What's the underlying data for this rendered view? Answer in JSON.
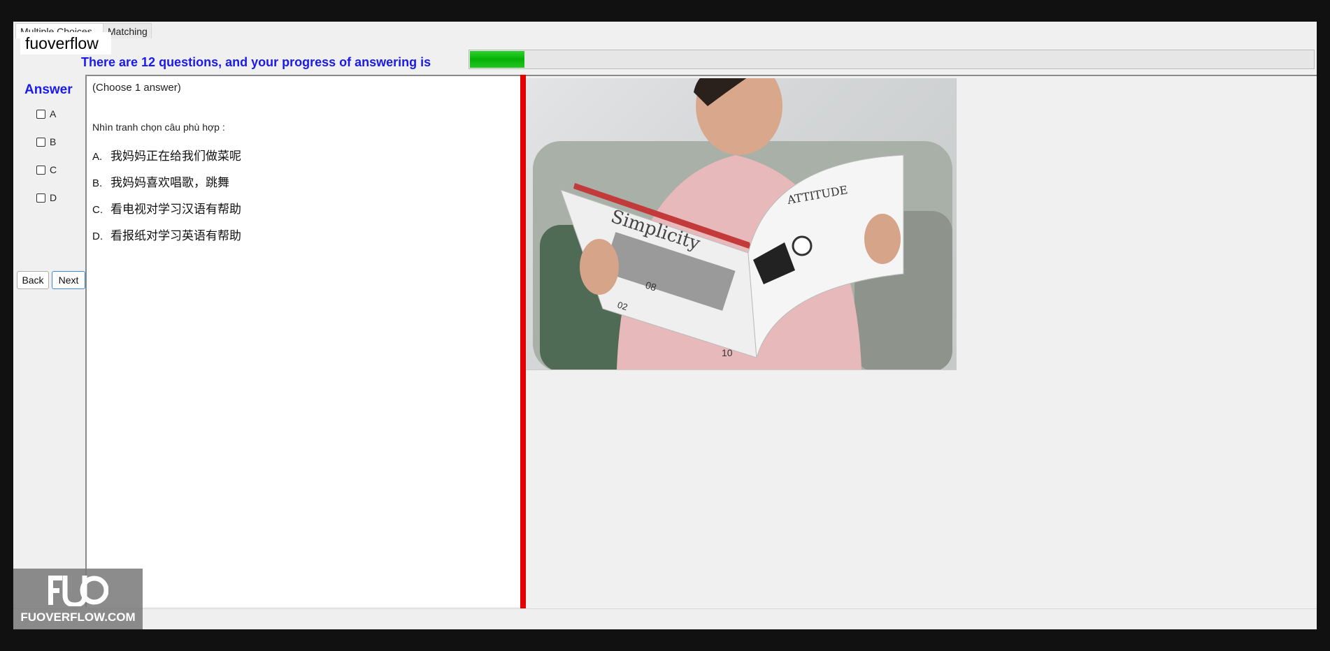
{
  "tabs": [
    {
      "label": "Multiple Choices"
    },
    {
      "label": "Matching"
    }
  ],
  "watermark": {
    "label": "fuoverflow",
    "site": "FUOVERFLOW.COM",
    "logo_text": "FUO"
  },
  "progress": {
    "text": "There are 12 questions, and your progress of answering is",
    "total_questions": 12,
    "fraction": 0.065,
    "bar_color": "#06b006"
  },
  "answer_panel": {
    "heading": "Answer",
    "options": [
      {
        "label": "A",
        "checked": false
      },
      {
        "label": "B",
        "checked": false
      },
      {
        "label": "C",
        "checked": false
      },
      {
        "label": "D",
        "checked": false
      }
    ],
    "back_label": "Back",
    "next_label": "Next"
  },
  "question": {
    "instruction": "(Choose 1 answer)",
    "prompt": "Nhìn tranh chọn câu phù hợp :",
    "answers": [
      {
        "letter": "A.",
        "text": "我妈妈正在给我们做菜呢"
      },
      {
        "letter": "B.",
        "text": "我妈妈喜欢唱歌，跳舞"
      },
      {
        "letter": "C.",
        "text": "看电视对学习汉语有帮助"
      },
      {
        "letter": "D.",
        "text": "看报纸对学习英语有帮助"
      }
    ]
  },
  "image": {
    "magazine_title": "Simplicity",
    "page_headline": "ATTITUDE",
    "page_numbers": [
      "08",
      "02",
      "10"
    ]
  },
  "colors": {
    "accent": "#1a1aee",
    "splitter": "#e20000"
  }
}
